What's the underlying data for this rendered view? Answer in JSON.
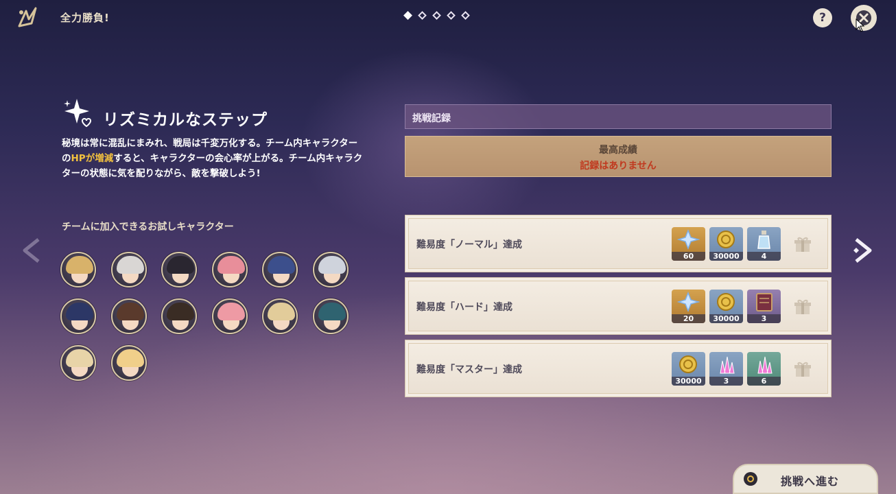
{
  "header": {
    "title": "全力勝負!",
    "pager": {
      "count": 5,
      "active_index": 0
    },
    "help_label": "?"
  },
  "event": {
    "name": "リズミカルなステップ",
    "description_part1": "秘境は常に混乱にまみれ、戦局は千変万化する。チーム内キャラクターの",
    "description_highlight": "HPが増減",
    "description_part2": "すると、キャラクターの会心率が上がる。チーム内キャラクターの状態に気を配りながら、敵を撃破しよう!",
    "highlight_color": "#f3c13e"
  },
  "trial_characters": {
    "title": "チームに加入できるお試しキャラクター",
    "characters": [
      {
        "hair": "#d8b26a"
      },
      {
        "hair": "#d9d6d4"
      },
      {
        "hair": "#2a2630"
      },
      {
        "hair": "#e88e9a"
      },
      {
        "hair": "#3c4f8c"
      },
      {
        "hair": "#cfd3dc"
      },
      {
        "hair": "#2c3766"
      },
      {
        "hair": "#5a3a2c"
      },
      {
        "hair": "#3a2c24"
      },
      {
        "hair": "#ee9aa4"
      },
      {
        "hair": "#e2cc9a"
      },
      {
        "hair": "#2f6370"
      },
      {
        "hair": "#e8d4a8"
      },
      {
        "hair": "#f0cf8a"
      }
    ]
  },
  "record": {
    "header": "挑戦記録",
    "best_label": "最高成績",
    "best_value": "記録はありません"
  },
  "rewards": [
    {
      "label": "難易度「ノーマル」達成",
      "items": [
        {
          "kind": "primogem",
          "bg": "gold",
          "count": "60"
        },
        {
          "kind": "mora",
          "bg": "blue",
          "count": "30000"
        },
        {
          "kind": "potion",
          "bg": "blue",
          "count": "4"
        }
      ]
    },
    {
      "label": "難易度「ハード」達成",
      "items": [
        {
          "kind": "primogem",
          "bg": "gold",
          "count": "20"
        },
        {
          "kind": "mora",
          "bg": "blue",
          "count": "30000"
        },
        {
          "kind": "book",
          "bg": "purple",
          "count": "3"
        }
      ]
    },
    {
      "label": "難易度「マスター」達成",
      "items": [
        {
          "kind": "mora",
          "bg": "blue",
          "count": "30000"
        },
        {
          "kind": "crystal",
          "bg": "blue",
          "count": "3"
        },
        {
          "kind": "crystal",
          "bg": "green",
          "count": "6"
        }
      ]
    }
  ],
  "actions": {
    "start_label": "挑戦へ進む"
  }
}
